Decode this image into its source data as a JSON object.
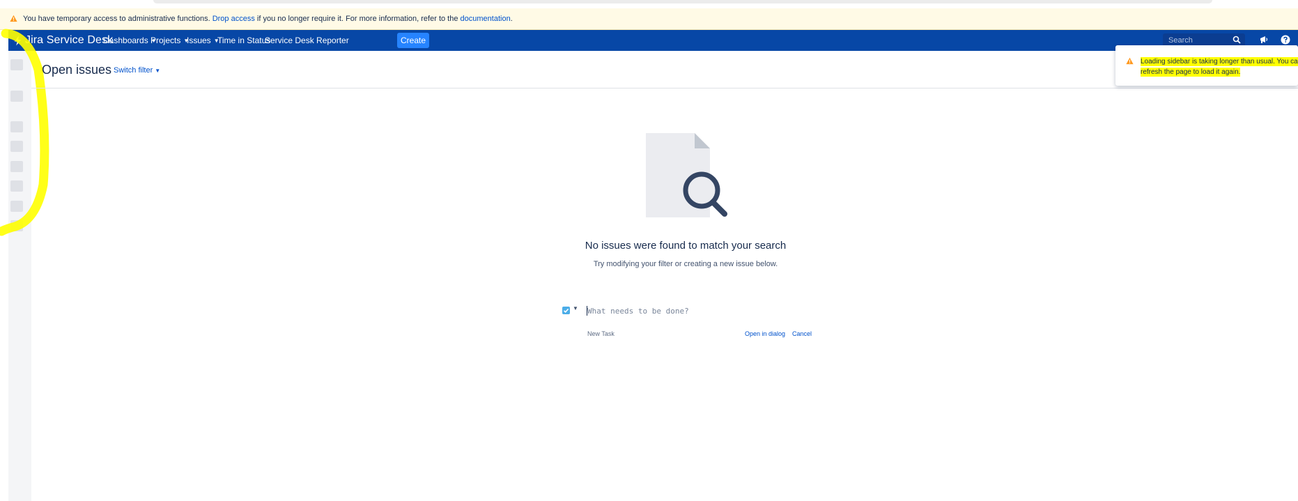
{
  "banner": {
    "text_1": "You have temporary access to administrative functions.",
    "link_drop": "Drop access",
    "text_2": "if you no longer require it. For more information, refer to the",
    "link_docs": "documentation",
    "text_3": "."
  },
  "nav": {
    "brand": "Jira Service Desk",
    "items": [
      {
        "label": "Dashboards",
        "has_menu": true
      },
      {
        "label": "Projects",
        "has_menu": true
      },
      {
        "label": "Issues",
        "has_menu": true
      },
      {
        "label": "Time in Status",
        "has_menu": false
      },
      {
        "label": "Service Desk Reporter",
        "has_menu": false
      }
    ],
    "create_label": "Create",
    "search_placeholder": "Search",
    "icons": [
      "search-icon",
      "announcement-icon",
      "help-icon"
    ]
  },
  "page": {
    "title": "Open issues",
    "switch_filter": "Switch filter"
  },
  "toast": {
    "message": "Loading sidebar is taking longer than usual. You can refresh the page to load it again."
  },
  "empty_state": {
    "title": "No issues were found to match your search",
    "subtitle": "Try modifying your filter or creating a new issue below."
  },
  "inline_create": {
    "placeholder": "What needs to be done?",
    "issue_type": "New Task",
    "open_dialog": "Open in dialog",
    "cancel": "Cancel"
  },
  "colors": {
    "nav_bg": "#0747a6",
    "create_btn": "#2684ff",
    "banner_bg": "#fffae6",
    "warning": "#ff991f",
    "link": "#0052cc",
    "annotation": "#ffff00"
  }
}
